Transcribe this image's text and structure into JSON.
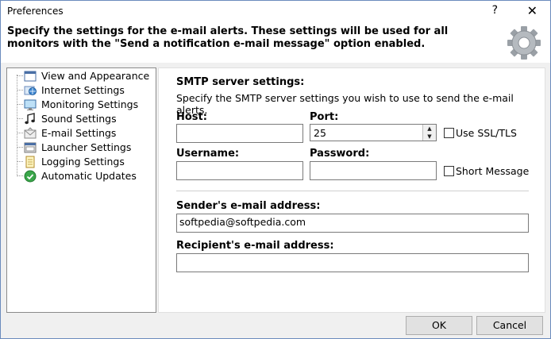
{
  "window": {
    "title": "Preferences",
    "help_label": "?",
    "close_label": "✕"
  },
  "header": {
    "text": "Specify the settings for the e-mail alerts. These settings will be used for all monitors with the \"Send a notification e-mail message\" option enabled."
  },
  "tree": {
    "items": [
      {
        "label": "View and Appearance",
        "icon": "window-icon"
      },
      {
        "label": "Internet Settings",
        "icon": "globe-icon"
      },
      {
        "label": "Monitoring Settings",
        "icon": "monitor-icon"
      },
      {
        "label": "Sound Settings",
        "icon": "music-note-icon"
      },
      {
        "label": "E-mail Settings",
        "icon": "envelope-icon"
      },
      {
        "label": "Launcher Settings",
        "icon": "launcher-icon"
      },
      {
        "label": "Logging Settings",
        "icon": "notepad-icon"
      },
      {
        "label": "Automatic Updates",
        "icon": "update-icon"
      }
    ]
  },
  "smtp": {
    "title": "SMTP server settings:",
    "description": "Specify the SMTP server settings you wish to use to send the e-mail alerts.",
    "host_label": "Host:",
    "host_value": "",
    "port_label": "Port:",
    "port_value": "25",
    "ssl_label": "Use SSL/TLS",
    "ssl_checked": false,
    "username_label": "Username:",
    "username_value": "",
    "password_label": "Password:",
    "password_value": "",
    "short_label": "Short Message",
    "short_checked": false
  },
  "sender": {
    "label": "Sender's e-mail address:",
    "value": "softpedia@softpedia.com"
  },
  "recipient": {
    "label": "Recipient's e-mail address:",
    "value": ""
  },
  "buttons": {
    "ok": "OK",
    "cancel": "Cancel"
  }
}
